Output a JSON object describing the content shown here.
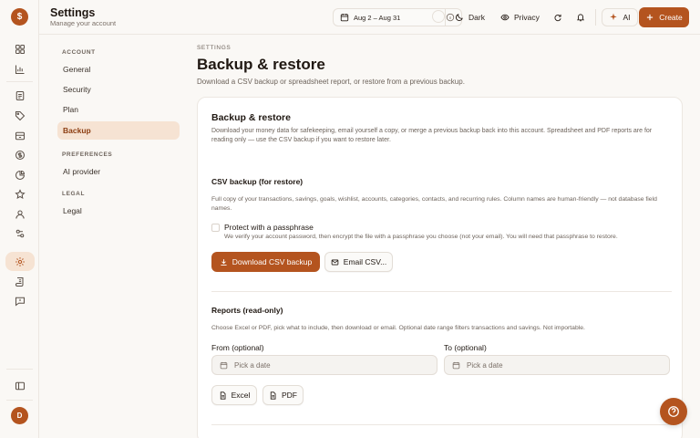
{
  "rail": {
    "logo_glyph": "$",
    "icons": [
      "dashboard-icon",
      "chart-icon",
      "document-icon",
      "tag-icon",
      "archive-icon",
      "dollar-icon",
      "pie-chart-icon",
      "star-icon",
      "user-icon",
      "contacts-icon",
      "gear-icon",
      "scroll-icon",
      "chat-icon",
      "sidebar-toggle-icon"
    ],
    "active": "gear-icon",
    "avatar_initial": "D"
  },
  "header": {
    "title": "Settings",
    "subtitle": "Manage your account",
    "date_range": "Aug 2 – Aug 31",
    "theme_label": "Dark",
    "privacy_label": "Privacy",
    "ai_label": "AI",
    "create_label": "Create"
  },
  "settings_nav": {
    "sections": [
      {
        "title": "ACCOUNT",
        "items": [
          "General",
          "Security",
          "Plan",
          "Backup"
        ]
      },
      {
        "title": "PREFERENCES",
        "items": [
          "AI provider"
        ]
      },
      {
        "title": "LEGAL",
        "items": [
          "Legal"
        ]
      }
    ],
    "active_item": "Backup"
  },
  "main": {
    "kicker": "SETTINGS",
    "title": "Backup & restore",
    "subtitle": "Download a CSV backup or spreadsheet report, or restore from a previous backup."
  },
  "card": {
    "title": "Backup & restore",
    "description": "Download your money data for safekeeping, email yourself a copy, or merge a previous backup back into this account. Spreadsheet and PDF reports are for reading only — use the CSV backup if you want to restore later.",
    "csv": {
      "title": "CSV backup (for restore)",
      "description": "Full copy of your transactions, savings, goals, wishlist, accounts, categories, contacts, and recurring rules. Column names are human-friendly — not database field names.",
      "passphrase_label": "Protect with a passphrase",
      "passphrase_help": "We verify your account password, then encrypt the file with a passphrase you choose (not your email). You will need that passphrase to restore.",
      "passphrase_checked": false,
      "download_label": "Download CSV backup",
      "email_label": "Email CSV..."
    },
    "reports": {
      "title": "Reports (read-only)",
      "description": "Choose Excel or PDF, pick what to include, then download or email. Optional date range filters transactions and savings. Not importable.",
      "from_label": "From (optional)",
      "to_label": "To (optional)",
      "from_placeholder": "Pick a date",
      "to_placeholder": "Pick a date",
      "excel_label": "Excel",
      "pdf_label": "PDF"
    }
  },
  "colors": {
    "accent": "#b4541f",
    "accent_soft": "#f6e3d3",
    "background": "#faf8f5"
  }
}
